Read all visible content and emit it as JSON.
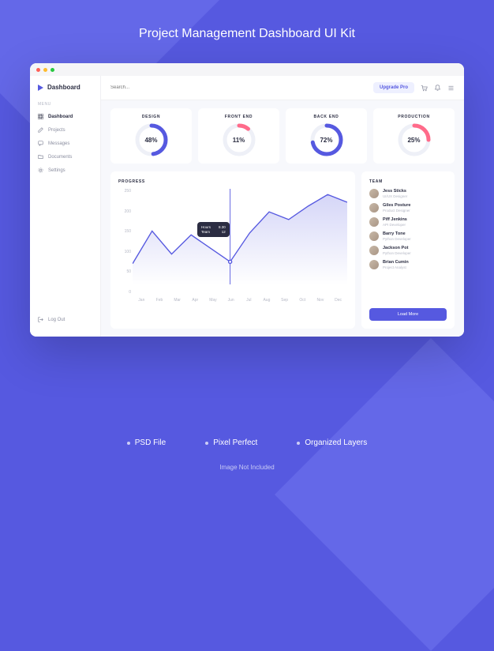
{
  "page_title": "Project Management Dashboard UI Kit",
  "brand": "Dashboard",
  "sidebar": {
    "section_label": "MENU",
    "items": [
      {
        "label": "Dashboard",
        "icon": "grid"
      },
      {
        "label": "Projects",
        "icon": "edit"
      },
      {
        "label": "Messages",
        "icon": "chat"
      },
      {
        "label": "Documents",
        "icon": "folder"
      },
      {
        "label": "Settings",
        "icon": "gear"
      }
    ],
    "logout_label": "Log Out"
  },
  "topbar": {
    "search_placeholder": "Search...",
    "upgrade_label": "Upgrade Pro"
  },
  "kpis": [
    {
      "title": "DESIGN",
      "value": "48%",
      "pct": 48,
      "color": "#5659e0"
    },
    {
      "title": "FRONT END",
      "value": "11%",
      "pct": 11,
      "color": "#ff6b8a"
    },
    {
      "title": "BACK END",
      "value": "72%",
      "pct": 72,
      "color": "#5659e0"
    },
    {
      "title": "PRODUCTION",
      "value": "25%",
      "pct": 25,
      "color": "#ff6b8a"
    }
  ],
  "progress": {
    "title": "PROGRESS",
    "tooltip": {
      "rows": [
        {
          "k": "Hours",
          "v": "8.30"
        },
        {
          "k": "Team",
          "v": "12"
        }
      ]
    }
  },
  "chart_data": {
    "type": "line",
    "title": "PROGRESS",
    "xlabel": "",
    "ylabel": "",
    "ylim": [
      0,
      250
    ],
    "y_ticks": [
      250,
      200,
      150,
      100,
      50,
      0
    ],
    "categories": [
      "Jan",
      "Feb",
      "Mar",
      "Apr",
      "May",
      "Jun",
      "Jul",
      "Aug",
      "Sep",
      "Oct",
      "Nov",
      "Dec"
    ],
    "series": [
      {
        "name": "progress",
        "values": [
          55,
          140,
          80,
          130,
          95,
          60,
          135,
          190,
          170,
          205,
          235,
          215
        ]
      }
    ],
    "highlight_index": 5,
    "area_fill": true
  },
  "team": {
    "title": "TEAM",
    "members": [
      {
        "name": "Jess Sticks",
        "role": "UI/UX Designer"
      },
      {
        "name": "Giles Posture",
        "role": "Product Designer"
      },
      {
        "name": "Piff Jenkins",
        "role": "API Developer"
      },
      {
        "name": "Barry Tone",
        "role": "Python Developer"
      },
      {
        "name": "Jackson Pot",
        "role": "Python Developer"
      },
      {
        "name": "Brian Cumin",
        "role": "Project Analyst"
      }
    ],
    "load_more_label": "Load More"
  },
  "footer": {
    "items": [
      "PSD File",
      "Pixel Perfect",
      "Organized Layers"
    ],
    "disclaimer": "Image Not Included"
  },
  "colors": {
    "primary": "#5659e0",
    "accent": "#ff6b8a",
    "text": "#2b2d42",
    "muted": "#b5b8c5"
  }
}
